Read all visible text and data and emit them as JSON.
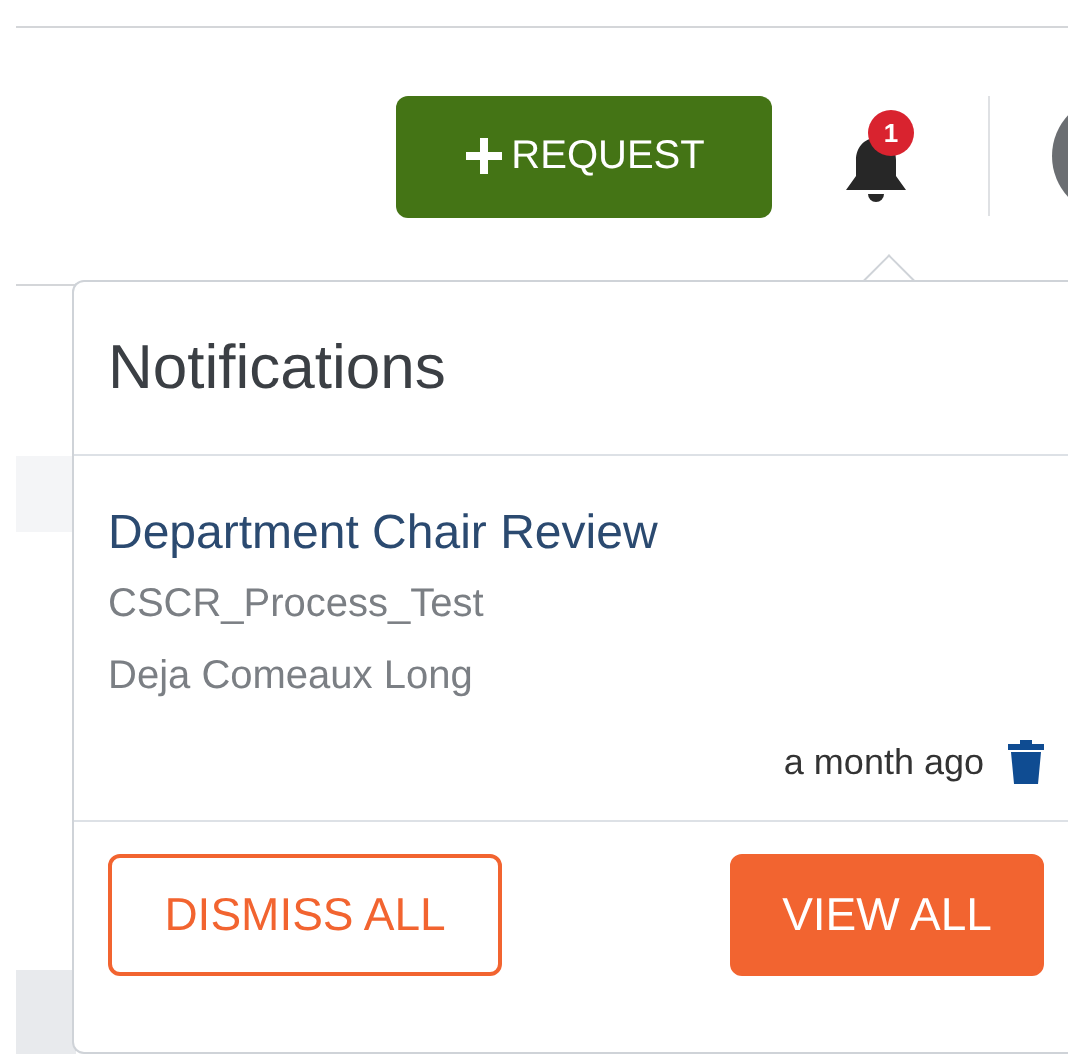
{
  "header": {
    "request_button": {
      "label": "REQUEST"
    },
    "notification_badge": "1"
  },
  "notifications_popup": {
    "title": "Notifications",
    "items": [
      {
        "title": "Department Chair Review",
        "process": "CSCR_Process_Test",
        "person": "Deja Comeaux Long",
        "time": "a month ago"
      }
    ],
    "buttons": [
      {
        "kind": "outline",
        "label": "DISMISS ALL"
      },
      {
        "kind": "filled",
        "label": "VIEW ALL"
      }
    ]
  }
}
